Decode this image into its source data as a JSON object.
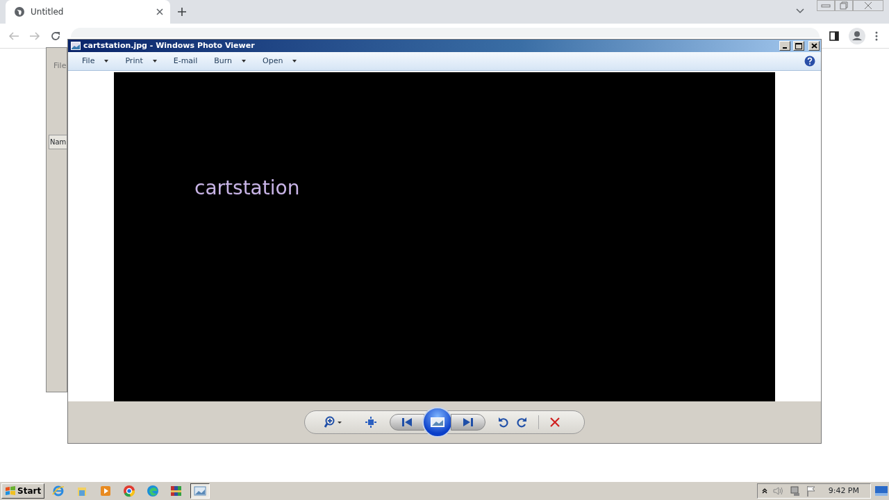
{
  "browser": {
    "tab": {
      "title": "Untitled",
      "selected": true
    }
  },
  "background_window": {
    "menu": [
      "File"
    ],
    "column_header": "Nam"
  },
  "photo_viewer": {
    "title": "cartstation.jpg - Windows Photo Viewer",
    "menu": [
      {
        "label": "File",
        "dropdown": true
      },
      {
        "label": "Print",
        "dropdown": true
      },
      {
        "label": "E-mail",
        "dropdown": false
      },
      {
        "label": "Burn",
        "dropdown": true
      },
      {
        "label": "Open",
        "dropdown": true
      }
    ],
    "image_text": "cartstation"
  },
  "taskbar": {
    "start": "Start",
    "apps": [
      {
        "kind": "ie",
        "selected": false
      },
      {
        "kind": "explorer",
        "selected": false
      },
      {
        "kind": "media",
        "selected": false
      },
      {
        "kind": "chrome",
        "selected": false
      },
      {
        "kind": "edge",
        "selected": false
      },
      {
        "kind": "winrar",
        "selected": false
      },
      {
        "kind": "photo",
        "selected": true
      }
    ],
    "clock": "9:42 PM"
  }
}
